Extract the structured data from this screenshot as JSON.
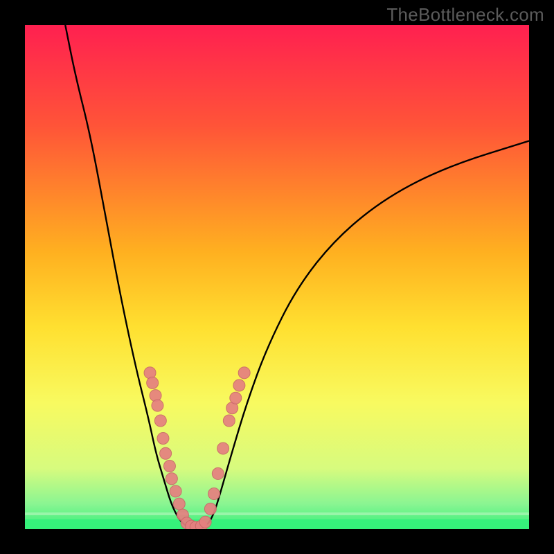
{
  "watermark": "TheBottleneck.com",
  "colors": {
    "curve_stroke": "#000000",
    "dot_fill": "#e58080",
    "dot_stroke": "#c86868",
    "green_band": "#35f07a",
    "green_band_light": "#b9f7bf"
  },
  "chart_data": {
    "type": "line",
    "title": "",
    "xlabel": "",
    "ylabel": "",
    "xlim": [
      0,
      100
    ],
    "ylim": [
      0,
      100
    ],
    "gradient_stops": [
      {
        "offset": 0,
        "color": "#ff2050"
      },
      {
        "offset": 20,
        "color": "#ff5438"
      },
      {
        "offset": 45,
        "color": "#ffb020"
      },
      {
        "offset": 60,
        "color": "#ffe030"
      },
      {
        "offset": 75,
        "color": "#f8fa60"
      },
      {
        "offset": 88,
        "color": "#d7fb7e"
      },
      {
        "offset": 95,
        "color": "#8af592"
      },
      {
        "offset": 100,
        "color": "#35f07a"
      }
    ],
    "series": [
      {
        "name": "bottleneck-curve",
        "points": [
          {
            "x": 8,
            "y": 100
          },
          {
            "x": 10,
            "y": 90
          },
          {
            "x": 13,
            "y": 78
          },
          {
            "x": 16,
            "y": 62
          },
          {
            "x": 19,
            "y": 46
          },
          {
            "x": 22,
            "y": 32
          },
          {
            "x": 24.5,
            "y": 22
          },
          {
            "x": 26,
            "y": 15
          },
          {
            "x": 27.5,
            "y": 10
          },
          {
            "x": 29,
            "y": 5
          },
          {
            "x": 30.5,
            "y": 2
          },
          {
            "x": 32,
            "y": 0.5
          },
          {
            "x": 34,
            "y": 0
          },
          {
            "x": 36,
            "y": 0.5
          },
          {
            "x": 37.5,
            "y": 3
          },
          {
            "x": 39,
            "y": 8
          },
          {
            "x": 41,
            "y": 15
          },
          {
            "x": 44,
            "y": 25
          },
          {
            "x": 48,
            "y": 36
          },
          {
            "x": 54,
            "y": 48
          },
          {
            "x": 62,
            "y": 58
          },
          {
            "x": 72,
            "y": 66
          },
          {
            "x": 84,
            "y": 72
          },
          {
            "x": 100,
            "y": 77
          }
        ]
      }
    ],
    "dots_left": [
      {
        "x": 24.8,
        "y": 31.0
      },
      {
        "x": 25.3,
        "y": 29.0
      },
      {
        "x": 25.9,
        "y": 26.5
      },
      {
        "x": 26.3,
        "y": 24.5
      },
      {
        "x": 26.9,
        "y": 21.5
      },
      {
        "x": 27.4,
        "y": 18.0
      },
      {
        "x": 27.9,
        "y": 15.0
      },
      {
        "x": 28.7,
        "y": 12.5
      },
      {
        "x": 29.1,
        "y": 10.0
      },
      {
        "x": 29.9,
        "y": 7.5
      },
      {
        "x": 30.6,
        "y": 5.0
      },
      {
        "x": 31.3,
        "y": 2.8
      }
    ],
    "dots_bottom": [
      {
        "x": 32.1,
        "y": 1.2
      },
      {
        "x": 33.0,
        "y": 0.6
      },
      {
        "x": 33.9,
        "y": 0.4
      },
      {
        "x": 35.0,
        "y": 0.6
      },
      {
        "x": 35.8,
        "y": 1.4
      }
    ],
    "dots_right": [
      {
        "x": 36.8,
        "y": 4.0
      },
      {
        "x": 37.5,
        "y": 7.0
      },
      {
        "x": 38.3,
        "y": 11.0
      },
      {
        "x": 39.3,
        "y": 16.0
      },
      {
        "x": 40.5,
        "y": 21.5
      },
      {
        "x": 41.1,
        "y": 24.0
      },
      {
        "x": 41.8,
        "y": 26.0
      },
      {
        "x": 42.5,
        "y": 28.5
      },
      {
        "x": 43.5,
        "y": 31.0
      }
    ]
  }
}
